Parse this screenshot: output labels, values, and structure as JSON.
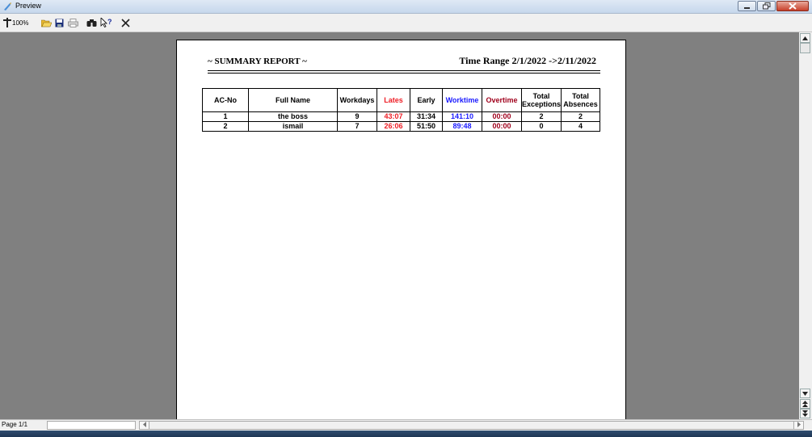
{
  "window": {
    "title": "Preview"
  },
  "toolbar": {
    "zoom_label": "100%"
  },
  "report": {
    "title": "~ SUMMARY REPORT ~",
    "time_range": "Time Range 2/1/2022 ->2/11/2022",
    "columns": {
      "ac_no": "AC-No",
      "full_name": "Full Name",
      "workdays": "Workdays",
      "lates": "Lates",
      "early": "Early",
      "worktime": "Worktime",
      "overtime": "Overtime",
      "exc_line1": "Total",
      "exc_line2": "Exceptions",
      "abs_line1": "Total",
      "abs_line2": "Absences"
    },
    "rows": [
      {
        "ac_no": "1",
        "full_name": "the boss",
        "workdays": "9",
        "lates": "43:07",
        "early": "31:34",
        "worktime": "141:10",
        "overtime": "00:00",
        "exceptions": "2",
        "absences": "2"
      },
      {
        "ac_no": "2",
        "full_name": "ismail",
        "workdays": "7",
        "lates": "26:06",
        "early": "51:50",
        "worktime": "89:48",
        "overtime": "00:00",
        "exceptions": "0",
        "absences": "4"
      }
    ]
  },
  "status": {
    "page": "Page 1/1"
  },
  "colors": {
    "lates": "#ee1c24",
    "worktime": "#1a1aff",
    "overtime": "#a0001c"
  }
}
